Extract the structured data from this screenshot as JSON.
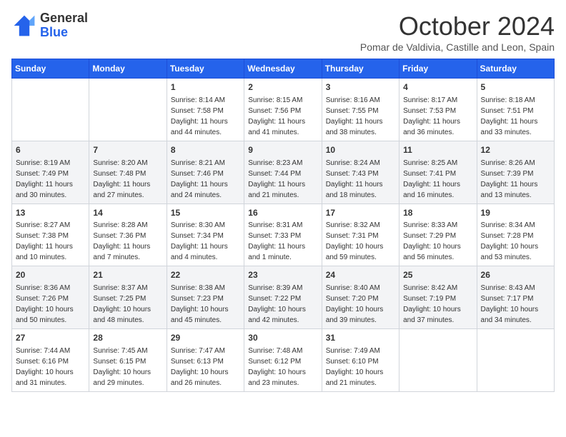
{
  "header": {
    "logo_general": "General",
    "logo_blue": "Blue",
    "month_title": "October 2024",
    "subtitle": "Pomar de Valdivia, Castille and Leon, Spain"
  },
  "days_of_week": [
    "Sunday",
    "Monday",
    "Tuesday",
    "Wednesday",
    "Thursday",
    "Friday",
    "Saturday"
  ],
  "weeks": [
    [
      {
        "day": "",
        "info": ""
      },
      {
        "day": "",
        "info": ""
      },
      {
        "day": "1",
        "info": "Sunrise: 8:14 AM\nSunset: 7:58 PM\nDaylight: 11 hours and 44 minutes."
      },
      {
        "day": "2",
        "info": "Sunrise: 8:15 AM\nSunset: 7:56 PM\nDaylight: 11 hours and 41 minutes."
      },
      {
        "day": "3",
        "info": "Sunrise: 8:16 AM\nSunset: 7:55 PM\nDaylight: 11 hours and 38 minutes."
      },
      {
        "day": "4",
        "info": "Sunrise: 8:17 AM\nSunset: 7:53 PM\nDaylight: 11 hours and 36 minutes."
      },
      {
        "day": "5",
        "info": "Sunrise: 8:18 AM\nSunset: 7:51 PM\nDaylight: 11 hours and 33 minutes."
      }
    ],
    [
      {
        "day": "6",
        "info": "Sunrise: 8:19 AM\nSunset: 7:49 PM\nDaylight: 11 hours and 30 minutes."
      },
      {
        "day": "7",
        "info": "Sunrise: 8:20 AM\nSunset: 7:48 PM\nDaylight: 11 hours and 27 minutes."
      },
      {
        "day": "8",
        "info": "Sunrise: 8:21 AM\nSunset: 7:46 PM\nDaylight: 11 hours and 24 minutes."
      },
      {
        "day": "9",
        "info": "Sunrise: 8:23 AM\nSunset: 7:44 PM\nDaylight: 11 hours and 21 minutes."
      },
      {
        "day": "10",
        "info": "Sunrise: 8:24 AM\nSunset: 7:43 PM\nDaylight: 11 hours and 18 minutes."
      },
      {
        "day": "11",
        "info": "Sunrise: 8:25 AM\nSunset: 7:41 PM\nDaylight: 11 hours and 16 minutes."
      },
      {
        "day": "12",
        "info": "Sunrise: 8:26 AM\nSunset: 7:39 PM\nDaylight: 11 hours and 13 minutes."
      }
    ],
    [
      {
        "day": "13",
        "info": "Sunrise: 8:27 AM\nSunset: 7:38 PM\nDaylight: 11 hours and 10 minutes."
      },
      {
        "day": "14",
        "info": "Sunrise: 8:28 AM\nSunset: 7:36 PM\nDaylight: 11 hours and 7 minutes."
      },
      {
        "day": "15",
        "info": "Sunrise: 8:30 AM\nSunset: 7:34 PM\nDaylight: 11 hours and 4 minutes."
      },
      {
        "day": "16",
        "info": "Sunrise: 8:31 AM\nSunset: 7:33 PM\nDaylight: 11 hours and 1 minute."
      },
      {
        "day": "17",
        "info": "Sunrise: 8:32 AM\nSunset: 7:31 PM\nDaylight: 10 hours and 59 minutes."
      },
      {
        "day": "18",
        "info": "Sunrise: 8:33 AM\nSunset: 7:29 PM\nDaylight: 10 hours and 56 minutes."
      },
      {
        "day": "19",
        "info": "Sunrise: 8:34 AM\nSunset: 7:28 PM\nDaylight: 10 hours and 53 minutes."
      }
    ],
    [
      {
        "day": "20",
        "info": "Sunrise: 8:36 AM\nSunset: 7:26 PM\nDaylight: 10 hours and 50 minutes."
      },
      {
        "day": "21",
        "info": "Sunrise: 8:37 AM\nSunset: 7:25 PM\nDaylight: 10 hours and 48 minutes."
      },
      {
        "day": "22",
        "info": "Sunrise: 8:38 AM\nSunset: 7:23 PM\nDaylight: 10 hours and 45 minutes."
      },
      {
        "day": "23",
        "info": "Sunrise: 8:39 AM\nSunset: 7:22 PM\nDaylight: 10 hours and 42 minutes."
      },
      {
        "day": "24",
        "info": "Sunrise: 8:40 AM\nSunset: 7:20 PM\nDaylight: 10 hours and 39 minutes."
      },
      {
        "day": "25",
        "info": "Sunrise: 8:42 AM\nSunset: 7:19 PM\nDaylight: 10 hours and 37 minutes."
      },
      {
        "day": "26",
        "info": "Sunrise: 8:43 AM\nSunset: 7:17 PM\nDaylight: 10 hours and 34 minutes."
      }
    ],
    [
      {
        "day": "27",
        "info": "Sunrise: 7:44 AM\nSunset: 6:16 PM\nDaylight: 10 hours and 31 minutes."
      },
      {
        "day": "28",
        "info": "Sunrise: 7:45 AM\nSunset: 6:15 PM\nDaylight: 10 hours and 29 minutes."
      },
      {
        "day": "29",
        "info": "Sunrise: 7:47 AM\nSunset: 6:13 PM\nDaylight: 10 hours and 26 minutes."
      },
      {
        "day": "30",
        "info": "Sunrise: 7:48 AM\nSunset: 6:12 PM\nDaylight: 10 hours and 23 minutes."
      },
      {
        "day": "31",
        "info": "Sunrise: 7:49 AM\nSunset: 6:10 PM\nDaylight: 10 hours and 21 minutes."
      },
      {
        "day": "",
        "info": ""
      },
      {
        "day": "",
        "info": ""
      }
    ]
  ]
}
